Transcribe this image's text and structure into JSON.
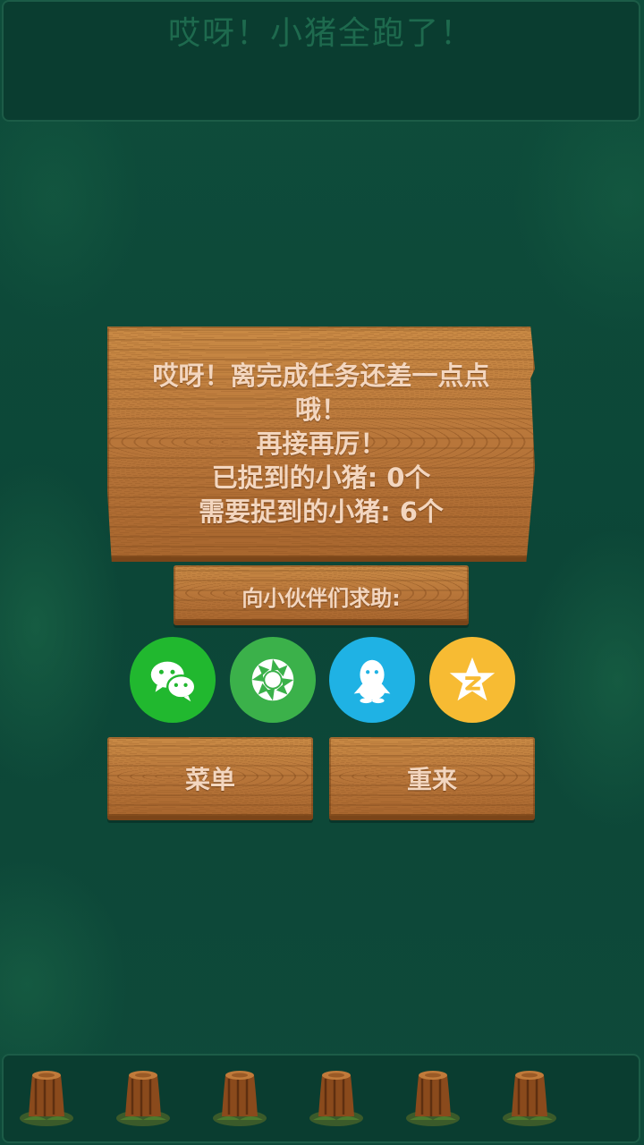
{
  "top_banner": {
    "title": "哎呀！小猪全跑了！"
  },
  "result_board": {
    "line1": "哎呀！离完成任务还差一点点",
    "line2": "哦！",
    "line3": "再接再厉！",
    "caught_line": "已捉到的小猪: 0个",
    "required_line": "需要捉到的小猪: 6个"
  },
  "help": {
    "label": "向小伙伴们求助:"
  },
  "share": [
    {
      "name": "wechat-icon",
      "color": "#21b82f"
    },
    {
      "name": "moments-icon",
      "color": "#3bb14a"
    },
    {
      "name": "qq-icon",
      "color": "#1fb2e4"
    },
    {
      "name": "qzone-icon",
      "color": "#f7bb33"
    }
  ],
  "buttons": {
    "menu": "菜单",
    "retry": "重来"
  },
  "bottom_bar": {
    "stump_count": 6
  }
}
